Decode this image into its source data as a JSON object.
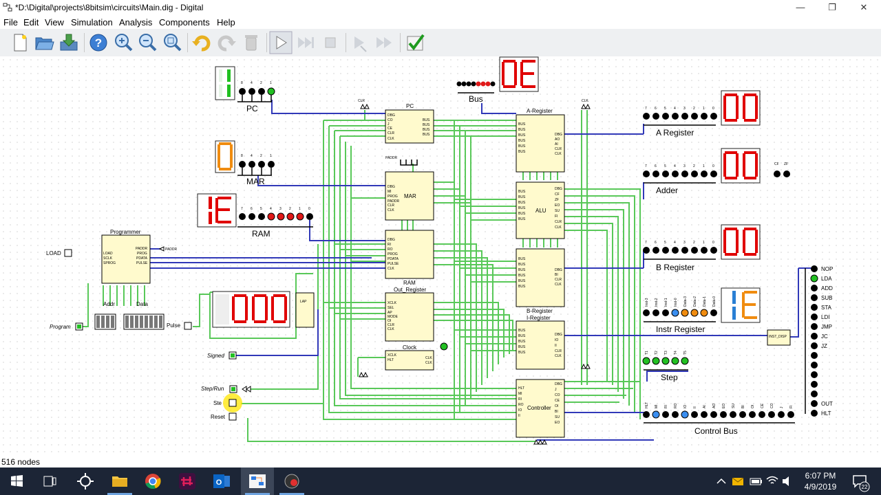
{
  "window": {
    "title": "*D:\\Digital\\projects\\8bitsim\\circuits\\Main.dig - Digital",
    "minimize": "—",
    "maximize": "❐",
    "close": "✕"
  },
  "menu": [
    "File",
    "Edit",
    "View",
    "Simulation",
    "Analysis",
    "Components",
    "Help"
  ],
  "toolbar": [
    "new-icon",
    "open-icon",
    "save-icon",
    "help-icon",
    "zoom-in-icon",
    "zoom-out-icon",
    "fit-icon",
    "undo-icon",
    "redo-icon",
    "delete-icon",
    "run-icon",
    "step-icon",
    "stop-icon",
    "micro-step-icon",
    "fast-run-icon",
    "analyse-icon"
  ],
  "circuit": {
    "pc": {
      "label": "PC",
      "digit": "1",
      "bits": [
        "8",
        "4",
        "2",
        "1"
      ],
      "block": "PC",
      "pins_left": [
        "DBG",
        "CO",
        "J",
        "CE",
        "CLR",
        "CLK"
      ],
      "pins_right": [
        "BUS",
        "BUS",
        "BUS",
        "BUS"
      ]
    },
    "mar": {
      "label": "MAR",
      "digit": "0",
      "bits": [
        "8",
        "4",
        "2",
        "1"
      ],
      "block": "MAR",
      "pins_left": [
        "DBG",
        "MI",
        "PROG",
        "PADDR",
        "CLR",
        "CLK"
      ],
      "top_pin": "PADDR"
    },
    "ram": {
      "label": "RAM",
      "digits": "1E",
      "bits": [
        "7",
        "6",
        "5",
        "4",
        "3",
        "2",
        "1",
        "0"
      ],
      "block": "RAM",
      "pins_left": [
        "DBG",
        "RI",
        "RO",
        "PROG",
        "PDATA",
        "PULSE",
        "CLK"
      ]
    },
    "bus": {
      "label": "Bus",
      "digits": "0E",
      "bits": [
        "7",
        "6",
        "5",
        "4",
        "3",
        "2",
        "1",
        "0"
      ]
    },
    "a_register": {
      "label": "A Register",
      "digits": "00",
      "block": "A-Register",
      "bits": [
        "7",
        "6",
        "5",
        "4",
        "3",
        "2",
        "1",
        "0"
      ]
    },
    "adder": {
      "label": "Adder",
      "digits": "00",
      "block": "ALU",
      "flags": [
        "CF",
        "ZF"
      ]
    },
    "b_register": {
      "label": "B Register",
      "digits": "00",
      "block": "B-Register",
      "bits": [
        "7",
        "6",
        "5",
        "4",
        "3",
        "2",
        "1",
        "0"
      ]
    },
    "instr_register": {
      "label": "Instr Register",
      "digits": "1E",
      "block": "I-Register",
      "bits": [
        "Inst-3",
        "Inst-2",
        "Inst-1",
        "Inst-0",
        "Data-3",
        "Data-2",
        "Data-1",
        "Data-0"
      ]
    },
    "inst_disp": "INST_DISP",
    "out_register": {
      "block": "Out_Register",
      "display": "000",
      "pins_left": [
        "XCLK",
        "SEL",
        "AP",
        "MODE",
        "OI",
        "CLR",
        "CLK"
      ]
    },
    "clock": {
      "block": "Clock",
      "pins_left": [
        "XCLK",
        "HLT"
      ],
      "pins_right": [
        "CLK",
        "CLK"
      ],
      "pins_bottom": [
        "RUN",
        "STEP"
      ]
    },
    "controller": {
      "block": "Controller"
    },
    "step": {
      "label": "Step",
      "bits": [
        "T1",
        "T2",
        "T3",
        "T4",
        "T5"
      ]
    },
    "control_bus": {
      "label": "Control  Bus",
      "bits": [
        "HLT",
        "MI",
        "RI",
        "RO",
        "IO",
        "II",
        "AI",
        "AO",
        "EO",
        "SU",
        "BI",
        "OI",
        "CE",
        "CO",
        "J",
        "FI"
      ]
    },
    "instructions": [
      "NOP",
      "LDA",
      "ADD",
      "SUB",
      "STA",
      "LDI",
      "JMP",
      "JC",
      "JZ",
      "",
      "",
      "",
      "",
      "",
      "OUT",
      "HLT"
    ],
    "programmer": {
      "block": "Programmer",
      "pins_left": [
        "LOAD",
        "SCLK",
        "SPROG"
      ],
      "pins_right": [
        "PADDR",
        "PROG",
        "PDATA",
        "PULSE"
      ],
      "padr_label": "PADDR"
    },
    "inputs": {
      "load": "LOAD",
      "program": "Program",
      "pulse": "Pulse",
      "signed": "Signed",
      "step_run": "Step/Run",
      "step": "Ste",
      "reset": "Reset",
      "addr": "Addr",
      "data": "Data",
      "lap": "LAP"
    },
    "clr_label": "CLR",
    "clk_label": "CLK"
  },
  "status": {
    "text": "516 nodes"
  },
  "taskbar": {
    "time": "6:07 PM",
    "date": "4/9/2019",
    "notifications": "22",
    "apps": [
      "start-icon",
      "task-view-icon",
      "cortana-icon",
      "file-explorer-icon",
      "chrome-icon",
      "slack-icon",
      "outlook-icon",
      "digital-app-icon",
      "obs-icon"
    ]
  },
  "colors": {
    "led_on_green": "#22c022",
    "led_on_red": "#e01818",
    "led_blue": "#3a8ef0",
    "led_orange": "#f08c10",
    "seg_red": "#e00000",
    "seg_green": "#20c020",
    "seg_orange": "#f08c10",
    "seg_blue": "#2a7fd4",
    "wire_green": "#58c858",
    "wire_blue": "#3038b8",
    "block_fill": "#fffacd"
  }
}
